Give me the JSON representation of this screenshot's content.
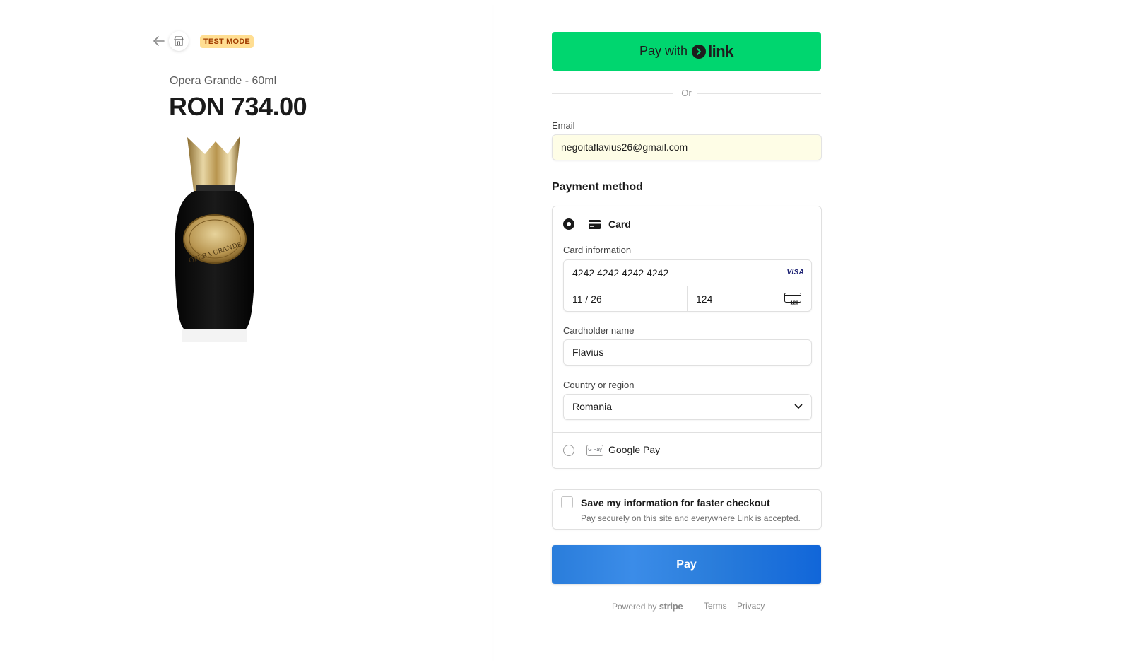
{
  "header": {
    "test_mode_badge": "TEST MODE"
  },
  "product": {
    "name": "Opera Grande - 60ml",
    "price": "RON 734.00",
    "bottle_label": "OPERA GRANDE"
  },
  "link_button": {
    "prefix": "Pay with",
    "brand": "link"
  },
  "separator": {
    "or_text": "Or"
  },
  "email": {
    "label": "Email",
    "value": "negoitaflavius26@gmail.com"
  },
  "payment": {
    "title": "Payment method",
    "card_option_label": "Card",
    "card_info_label": "Card information",
    "card_number": "4242 4242 4242 4242",
    "card_brand": "VISA",
    "expiry": "11 / 26",
    "cvc": "124",
    "cvc_icon_text": "123",
    "cardholder_label": "Cardholder name",
    "cardholder_value": "Flavius",
    "country_label": "Country or region",
    "country_value": "Romania",
    "gpay_option_label": "Google Pay",
    "gpay_logo_text": "G Pay"
  },
  "save_info": {
    "title": "Save my information for faster checkout",
    "subtitle": "Pay securely on this site and everywhere Link is accepted."
  },
  "pay_button": {
    "label": "Pay"
  },
  "footer": {
    "powered_by": "Powered by",
    "brand": "stripe",
    "terms": "Terms",
    "privacy": "Privacy"
  },
  "colors": {
    "link_green": "#00d66f",
    "pay_blue": "#2a7ddb",
    "test_badge_bg": "#ffde92",
    "test_badge_text": "#a13c00",
    "email_autofill_bg": "#fefde6"
  }
}
